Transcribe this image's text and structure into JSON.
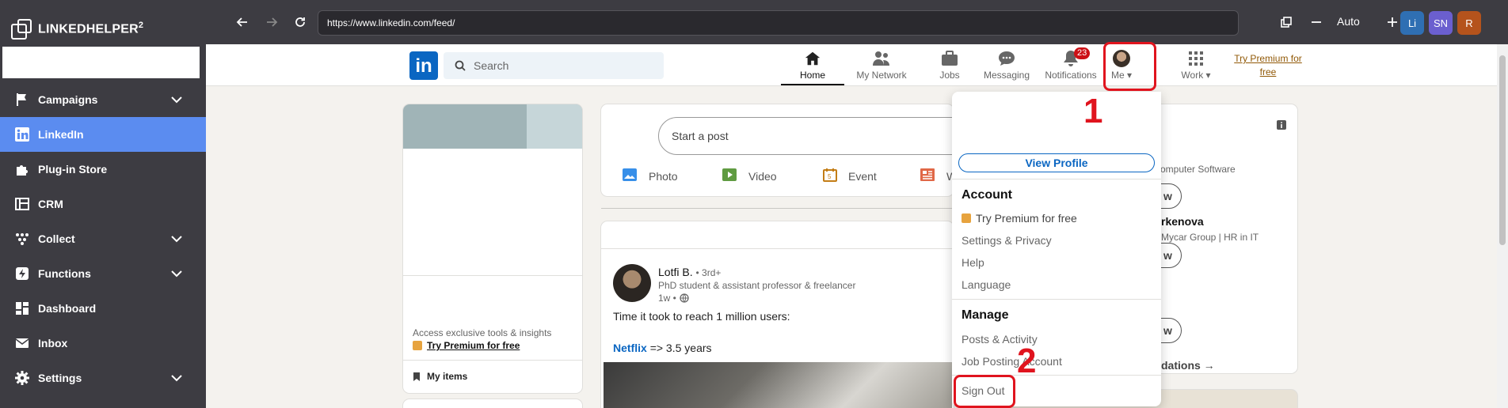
{
  "app": {
    "brand": "LINKEDHELPER",
    "brand_sup": "2",
    "nav": [
      {
        "label": "Campaigns",
        "icon": "flag-icon",
        "chevron": true
      },
      {
        "label": "LinkedIn",
        "icon": "linkedin-icon",
        "chevron": false,
        "active": true
      },
      {
        "label": "Plug-in Store",
        "icon": "puzzle-icon",
        "chevron": false
      },
      {
        "label": "CRM",
        "icon": "crm-icon",
        "chevron": false
      },
      {
        "label": "Collect",
        "icon": "collect-icon",
        "chevron": true
      },
      {
        "label": "Functions",
        "icon": "bolt-icon",
        "chevron": true
      },
      {
        "label": "Dashboard",
        "icon": "dashboard-icon",
        "chevron": false
      },
      {
        "label": "Inbox",
        "icon": "mail-icon",
        "chevron": false
      },
      {
        "label": "Settings",
        "icon": "gear-icon",
        "chevron": true
      }
    ]
  },
  "browser": {
    "url": "https://www.linkedin.com/feed/",
    "zoom": "Auto",
    "accounts": [
      {
        "label": "Li",
        "color": "#2f6fb3"
      },
      {
        "label": "SN",
        "color": "#6b5fcf"
      },
      {
        "label": "R",
        "color": "#b5531c"
      }
    ]
  },
  "linkedin": {
    "logo": "in",
    "search_placeholder": "Search",
    "nav": {
      "home": "Home",
      "network": "My Network",
      "jobs": "Jobs",
      "messaging": "Messaging",
      "notifications": "Notifications",
      "notifications_count": "23",
      "me": "Me",
      "work": "Work"
    },
    "premium_line1": "Try Premium for",
    "premium_line2": "free",
    "profile_card": {
      "access_text": "Access exclusive tools & insights",
      "premium": "Try Premium for free",
      "my_items": "My items"
    },
    "composer": {
      "placeholder": "Start a post",
      "actions": [
        "Photo",
        "Video",
        "Event",
        "W"
      ]
    },
    "post": {
      "author": "Lotfi B.",
      "degree": "• 3rd+",
      "headline": "PhD student & assistant professor & freelancer",
      "time": "1w •",
      "text1": "Time it took to reach 1 million users:",
      "link": "Netflix",
      "text2": "=> 3.5 years"
    },
    "right": {
      "line1": "omputer Software",
      "name": "rkenova",
      "line2": "Mycar Group | HR in IT",
      "btn": "w",
      "recs": "dations →"
    },
    "dropdown": {
      "view_profile": "View Profile",
      "account_heading": "Account",
      "try_premium": "Try Premium for free",
      "settings": "Settings & Privacy",
      "help": "Help",
      "language": "Language",
      "manage_heading": "Manage",
      "posts": "Posts & Activity",
      "job_posting": "Job Posting Account",
      "sign_out": "Sign Out"
    }
  },
  "annotations": {
    "step1": "1",
    "step2": "2"
  }
}
